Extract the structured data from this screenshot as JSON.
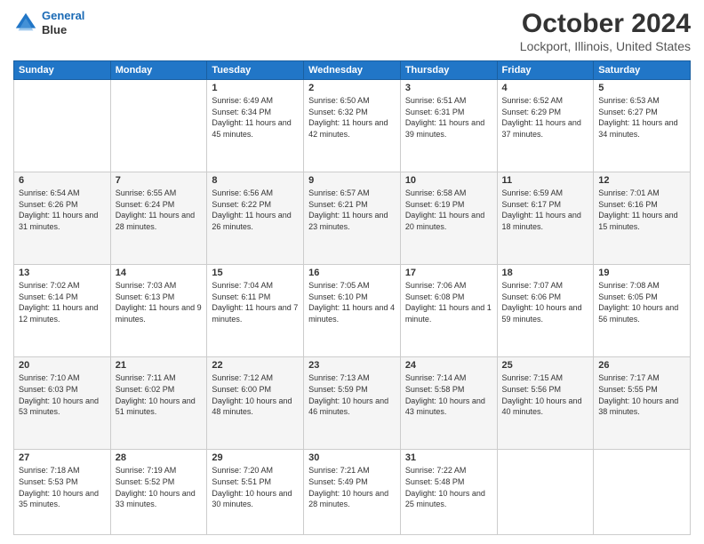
{
  "header": {
    "logo_line1": "General",
    "logo_line2": "Blue",
    "main_title": "October 2024",
    "subtitle": "Lockport, Illinois, United States"
  },
  "days_of_week": [
    "Sunday",
    "Monday",
    "Tuesday",
    "Wednesday",
    "Thursday",
    "Friday",
    "Saturday"
  ],
  "weeks": [
    [
      {
        "num": "",
        "info": ""
      },
      {
        "num": "",
        "info": ""
      },
      {
        "num": "1",
        "info": "Sunrise: 6:49 AM\nSunset: 6:34 PM\nDaylight: 11 hours and 45 minutes."
      },
      {
        "num": "2",
        "info": "Sunrise: 6:50 AM\nSunset: 6:32 PM\nDaylight: 11 hours and 42 minutes."
      },
      {
        "num": "3",
        "info": "Sunrise: 6:51 AM\nSunset: 6:31 PM\nDaylight: 11 hours and 39 minutes."
      },
      {
        "num": "4",
        "info": "Sunrise: 6:52 AM\nSunset: 6:29 PM\nDaylight: 11 hours and 37 minutes."
      },
      {
        "num": "5",
        "info": "Sunrise: 6:53 AM\nSunset: 6:27 PM\nDaylight: 11 hours and 34 minutes."
      }
    ],
    [
      {
        "num": "6",
        "info": "Sunrise: 6:54 AM\nSunset: 6:26 PM\nDaylight: 11 hours and 31 minutes."
      },
      {
        "num": "7",
        "info": "Sunrise: 6:55 AM\nSunset: 6:24 PM\nDaylight: 11 hours and 28 minutes."
      },
      {
        "num": "8",
        "info": "Sunrise: 6:56 AM\nSunset: 6:22 PM\nDaylight: 11 hours and 26 minutes."
      },
      {
        "num": "9",
        "info": "Sunrise: 6:57 AM\nSunset: 6:21 PM\nDaylight: 11 hours and 23 minutes."
      },
      {
        "num": "10",
        "info": "Sunrise: 6:58 AM\nSunset: 6:19 PM\nDaylight: 11 hours and 20 minutes."
      },
      {
        "num": "11",
        "info": "Sunrise: 6:59 AM\nSunset: 6:17 PM\nDaylight: 11 hours and 18 minutes."
      },
      {
        "num": "12",
        "info": "Sunrise: 7:01 AM\nSunset: 6:16 PM\nDaylight: 11 hours and 15 minutes."
      }
    ],
    [
      {
        "num": "13",
        "info": "Sunrise: 7:02 AM\nSunset: 6:14 PM\nDaylight: 11 hours and 12 minutes."
      },
      {
        "num": "14",
        "info": "Sunrise: 7:03 AM\nSunset: 6:13 PM\nDaylight: 11 hours and 9 minutes."
      },
      {
        "num": "15",
        "info": "Sunrise: 7:04 AM\nSunset: 6:11 PM\nDaylight: 11 hours and 7 minutes."
      },
      {
        "num": "16",
        "info": "Sunrise: 7:05 AM\nSunset: 6:10 PM\nDaylight: 11 hours and 4 minutes."
      },
      {
        "num": "17",
        "info": "Sunrise: 7:06 AM\nSunset: 6:08 PM\nDaylight: 11 hours and 1 minute."
      },
      {
        "num": "18",
        "info": "Sunrise: 7:07 AM\nSunset: 6:06 PM\nDaylight: 10 hours and 59 minutes."
      },
      {
        "num": "19",
        "info": "Sunrise: 7:08 AM\nSunset: 6:05 PM\nDaylight: 10 hours and 56 minutes."
      }
    ],
    [
      {
        "num": "20",
        "info": "Sunrise: 7:10 AM\nSunset: 6:03 PM\nDaylight: 10 hours and 53 minutes."
      },
      {
        "num": "21",
        "info": "Sunrise: 7:11 AM\nSunset: 6:02 PM\nDaylight: 10 hours and 51 minutes."
      },
      {
        "num": "22",
        "info": "Sunrise: 7:12 AM\nSunset: 6:00 PM\nDaylight: 10 hours and 48 minutes."
      },
      {
        "num": "23",
        "info": "Sunrise: 7:13 AM\nSunset: 5:59 PM\nDaylight: 10 hours and 46 minutes."
      },
      {
        "num": "24",
        "info": "Sunrise: 7:14 AM\nSunset: 5:58 PM\nDaylight: 10 hours and 43 minutes."
      },
      {
        "num": "25",
        "info": "Sunrise: 7:15 AM\nSunset: 5:56 PM\nDaylight: 10 hours and 40 minutes."
      },
      {
        "num": "26",
        "info": "Sunrise: 7:17 AM\nSunset: 5:55 PM\nDaylight: 10 hours and 38 minutes."
      }
    ],
    [
      {
        "num": "27",
        "info": "Sunrise: 7:18 AM\nSunset: 5:53 PM\nDaylight: 10 hours and 35 minutes."
      },
      {
        "num": "28",
        "info": "Sunrise: 7:19 AM\nSunset: 5:52 PM\nDaylight: 10 hours and 33 minutes."
      },
      {
        "num": "29",
        "info": "Sunrise: 7:20 AM\nSunset: 5:51 PM\nDaylight: 10 hours and 30 minutes."
      },
      {
        "num": "30",
        "info": "Sunrise: 7:21 AM\nSunset: 5:49 PM\nDaylight: 10 hours and 28 minutes."
      },
      {
        "num": "31",
        "info": "Sunrise: 7:22 AM\nSunset: 5:48 PM\nDaylight: 10 hours and 25 minutes."
      },
      {
        "num": "",
        "info": ""
      },
      {
        "num": "",
        "info": ""
      }
    ]
  ]
}
